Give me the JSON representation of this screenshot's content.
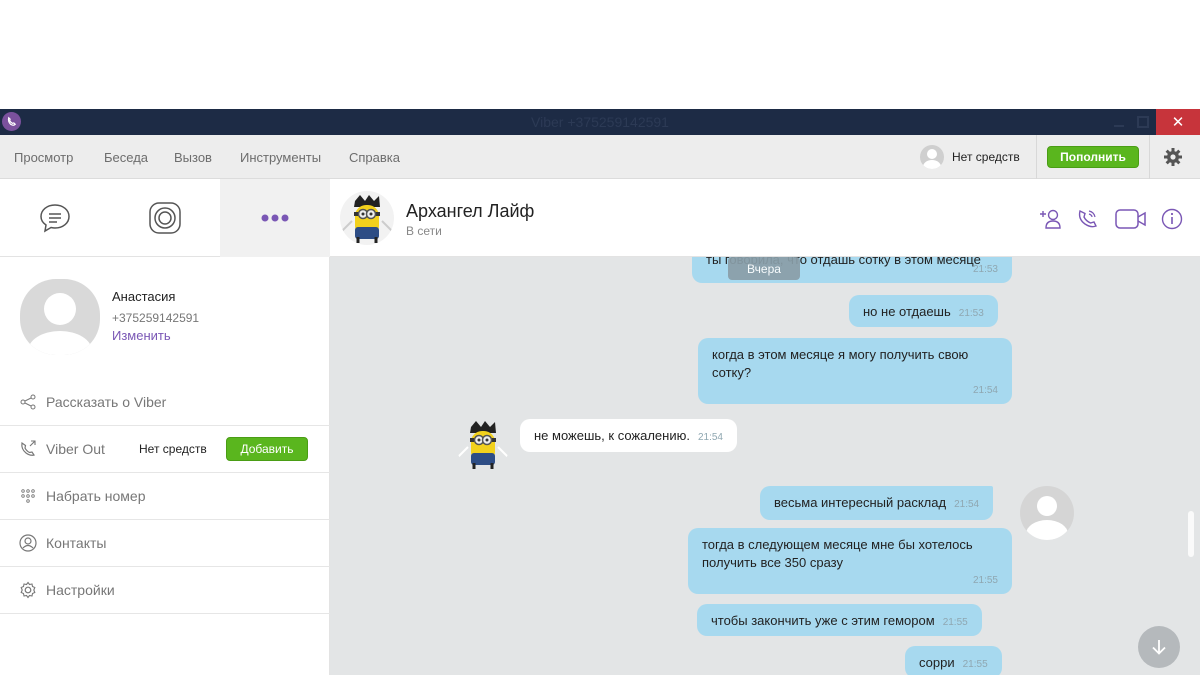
{
  "window": {
    "title": "Viber +375259142591"
  },
  "menu": {
    "items": [
      "Просмотр",
      "Беседа",
      "Вызов",
      "Инструменты",
      "Справка"
    ]
  },
  "account": {
    "balance_text": "Нет средств",
    "topup_label": "Пополнить"
  },
  "profile": {
    "name": "Анастасия",
    "phone": "+375259142591",
    "edit_label": "Изменить"
  },
  "sidebar": {
    "tell_friends": "Рассказать о Viber",
    "viber_out": "Viber Out",
    "viber_out_balance": "Нет средств",
    "viber_out_add": "Добавить",
    "dial": "Набрать номер",
    "contacts": "Контакты",
    "settings": "Настройки"
  },
  "chat": {
    "contact_name": "Архангел Лайф",
    "contact_status": "В сети",
    "date_separator": "Вчера",
    "messages": [
      {
        "dir": "out",
        "text": "ты говорила, что отдашь сотку в этом месяце",
        "time": "21:53"
      },
      {
        "dir": "out",
        "text": "но не отдаешь",
        "time": "21:53"
      },
      {
        "dir": "out",
        "text": "когда в этом месяце я могу получить свою сотку?",
        "time": "21:54"
      },
      {
        "dir": "in",
        "text": "не можешь, к сожалению.",
        "time": "21:54"
      },
      {
        "dir": "out",
        "text": "весьма интересный расклад",
        "time": "21:54"
      },
      {
        "dir": "out",
        "text": "тогда в следующем месяце мне бы хотелось получить все 350 сразу",
        "time": "21:55"
      },
      {
        "dir": "out",
        "text": "чтобы закончить уже с этим гемором",
        "time": "21:55"
      },
      {
        "dir": "out",
        "text": "сорри",
        "time": "21:55"
      }
    ]
  },
  "colors": {
    "accent": "#7a57b5",
    "green": "#5ab61e",
    "bubble_out": "#a7d9ef",
    "chat_bg": "#e3e5e6",
    "titlebar": "#1d2b45"
  }
}
